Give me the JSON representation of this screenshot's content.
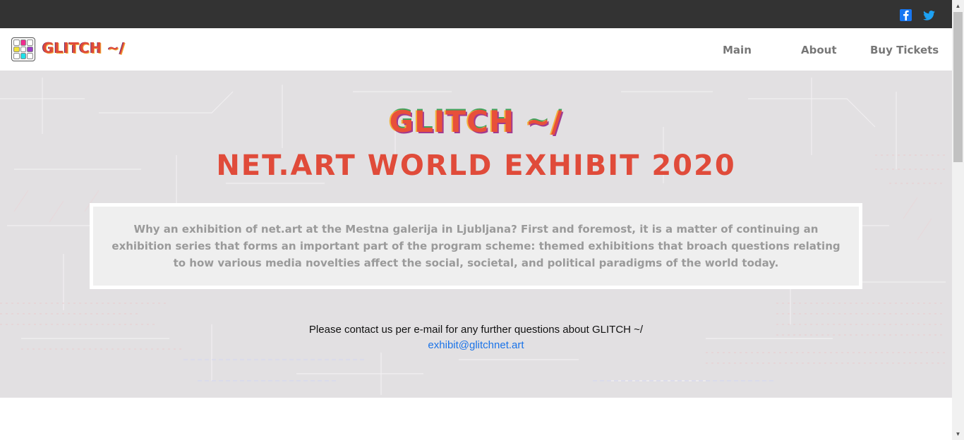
{
  "social": {
    "facebook_icon": "facebook-icon",
    "twitter_icon": "twitter-icon"
  },
  "nav": {
    "logo_text": "GLITCH ~/",
    "links": [
      "Main",
      "About",
      "Buy Tickets"
    ]
  },
  "hero": {
    "glitch_title": "GLITCH ~/",
    "title": "NET.ART WORLD EXHIBIT 2020",
    "quote": "Why an exhibition of net.art at the Mestna galerija in Ljubljana? First and foremost, it is a matter of continuing an exhibition series that forms an important part of the program scheme: themed exhibitions that broach questions relating to how various media novelties affect the social, societal, and political paradigms of the world today.",
    "contact_text": "Please contact us per e-mail for any further questions about GLITCH ~/",
    "email": "exhibit@glitchnet.art"
  },
  "colors": {
    "accent": "#e04b3a",
    "topbar": "#333333",
    "link": "#1a73e8"
  }
}
